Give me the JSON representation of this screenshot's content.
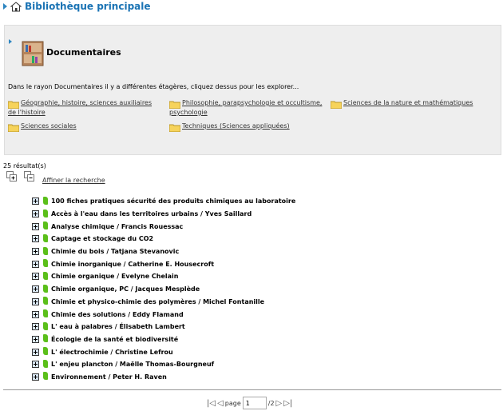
{
  "header": {
    "title": "Bibliothèque principale"
  },
  "panel": {
    "title": "Documentaires",
    "description": "Dans le rayon Documentaires il y a différentes étagères, cliquez dessus pour les explorer...",
    "categories": [
      {
        "line1": "Géographie, histoire, sciences auxiliaires",
        "line2": "de l'histoire"
      },
      {
        "line1": "Philosophie, parapsychologie et occultisme,",
        "line2": "psychologie"
      },
      {
        "line1": "Sciences de la nature et mathématiques",
        "line2": ""
      },
      {
        "line1": "Sciences sociales",
        "line2": ""
      },
      {
        "line1": "Techniques (Sciences appliquées)",
        "line2": ""
      }
    ]
  },
  "results": {
    "count_label": "25 résultat(s)",
    "refine_label": "Affiner la recherche",
    "items": [
      "100 fiches pratiques sécurité des produits chimiques au laboratoire",
      "Accès à l'eau dans les territoires urbains / Yves Saillard",
      "Analyse chimique / Francis Rouessac",
      "Captage et stockage du CO2",
      "Chimie du bois / Tatjana Stevanovic",
      "Chimie inorganique / Catherine E. Housecroft",
      "Chimie organique / Evelyne Chelain",
      "Chimie organique, PC / Jacques Mesplède",
      "Chimie et physico-chimie des polymères / Michel Fontanille",
      "Chimie des solutions / Eddy Flamand",
      "L' eau à palabres / Élisabeth Lambert",
      "Écologie de la santé et biodiversité",
      "L' électrochimie / Christine Lefrou",
      "L' enjeu plancton / Maëlle Thomas-Bourgneuf",
      "Environnement / Peter H. Raven"
    ]
  },
  "pager": {
    "page_label": "page",
    "current_page": "1",
    "total": "/2"
  }
}
